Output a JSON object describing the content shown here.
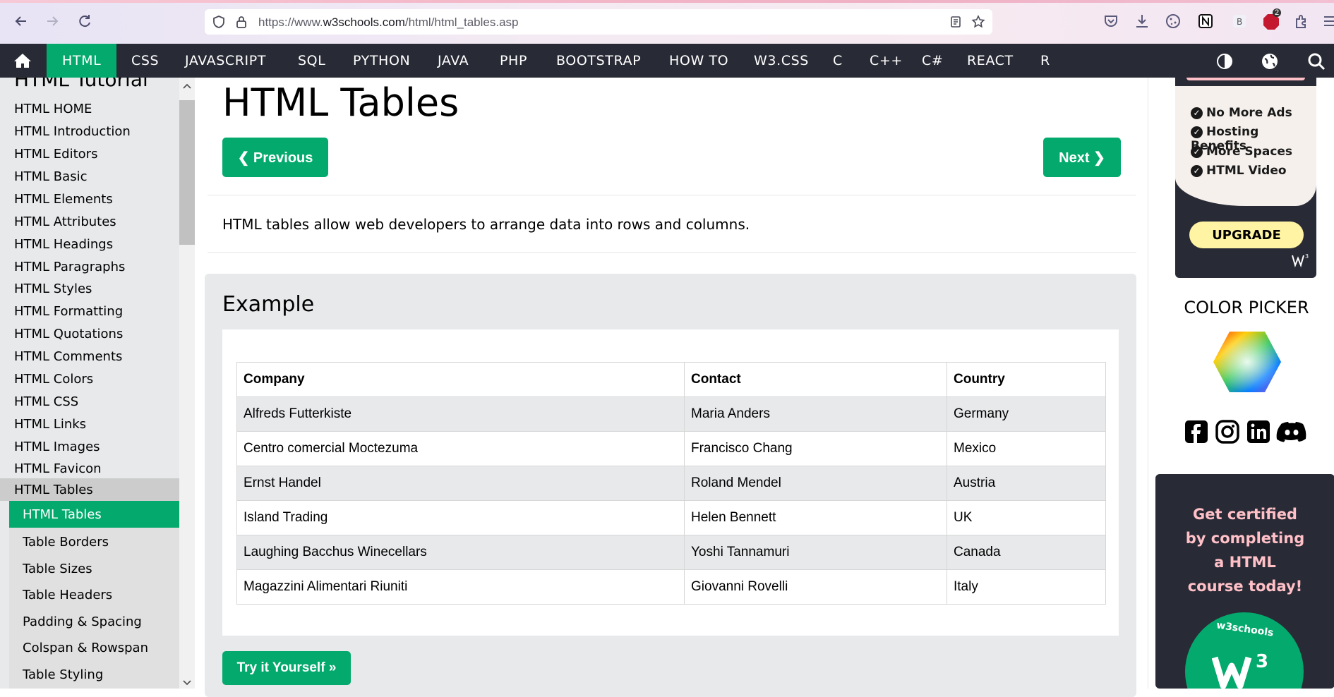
{
  "browser": {
    "url_prefix": "https://www.",
    "url_domain": "w3schools.com",
    "url_path": "/html/html_tables.asp",
    "tab_badge": "2"
  },
  "topnav": {
    "items": [
      "HTML",
      "CSS",
      "JAVASCRIPT",
      "SQL",
      "PYTHON",
      "JAVA",
      "PHP",
      "BOOTSTRAP",
      "HOW TO",
      "W3.CSS",
      "C",
      "C++",
      "C#",
      "REACT",
      "R"
    ]
  },
  "sidebar": {
    "title": "HTML Tutorial",
    "links": [
      "HTML HOME",
      "HTML Introduction",
      "HTML Editors",
      "HTML Basic",
      "HTML Elements",
      "HTML Attributes",
      "HTML Headings",
      "HTML Paragraphs",
      "HTML Styles",
      "HTML Formatting",
      "HTML Quotations",
      "HTML Comments",
      "HTML Colors",
      "HTML CSS",
      "HTML Links",
      "HTML Images",
      "HTML Favicon"
    ],
    "group_head": "HTML Tables",
    "sub_items": [
      "HTML Tables",
      "Table Borders",
      "Table Sizes",
      "Table Headers",
      "Padding & Spacing",
      "Colspan & Rowspan",
      "Table Styling"
    ]
  },
  "main": {
    "title": "HTML Tables",
    "prev_label": "❮ Previous",
    "next_label": "Next ❯",
    "intro": "HTML tables allow web developers to arrange data into rows and columns.",
    "example_heading": "Example",
    "try_label": "Try it Yourself »",
    "table": {
      "headers": [
        "Company",
        "Contact",
        "Country"
      ],
      "rows": [
        [
          "Alfreds Futterkiste",
          "Maria Anders",
          "Germany"
        ],
        [
          "Centro comercial Moctezuma",
          "Francisco Chang",
          "Mexico"
        ],
        [
          "Ernst Handel",
          "Roland Mendel",
          "Austria"
        ],
        [
          "Island Trading",
          "Helen Bennett",
          "UK"
        ],
        [
          "Laughing Bacchus Winecellars",
          "Yoshi Tannamuri",
          "Canada"
        ],
        [
          "Magazzini Alimentari Riuniti",
          "Giovanni Rovelli",
          "Italy"
        ]
      ]
    }
  },
  "right": {
    "ad_features": [
      "No More Ads",
      "Hosting Benefits",
      "More Spaces",
      "HTML Video"
    ],
    "upgrade_label": "UPGRADE",
    "color_picker_title": "COLOR PICKER",
    "cert_lines": [
      "Get certified",
      "by completing",
      "a HTML",
      "course today!"
    ],
    "badge_text": "w3schools"
  },
  "colors": {
    "accent": "#04aa6d",
    "nav_bg": "#282a35",
    "sidebar_bg": "#e7e9eb"
  }
}
